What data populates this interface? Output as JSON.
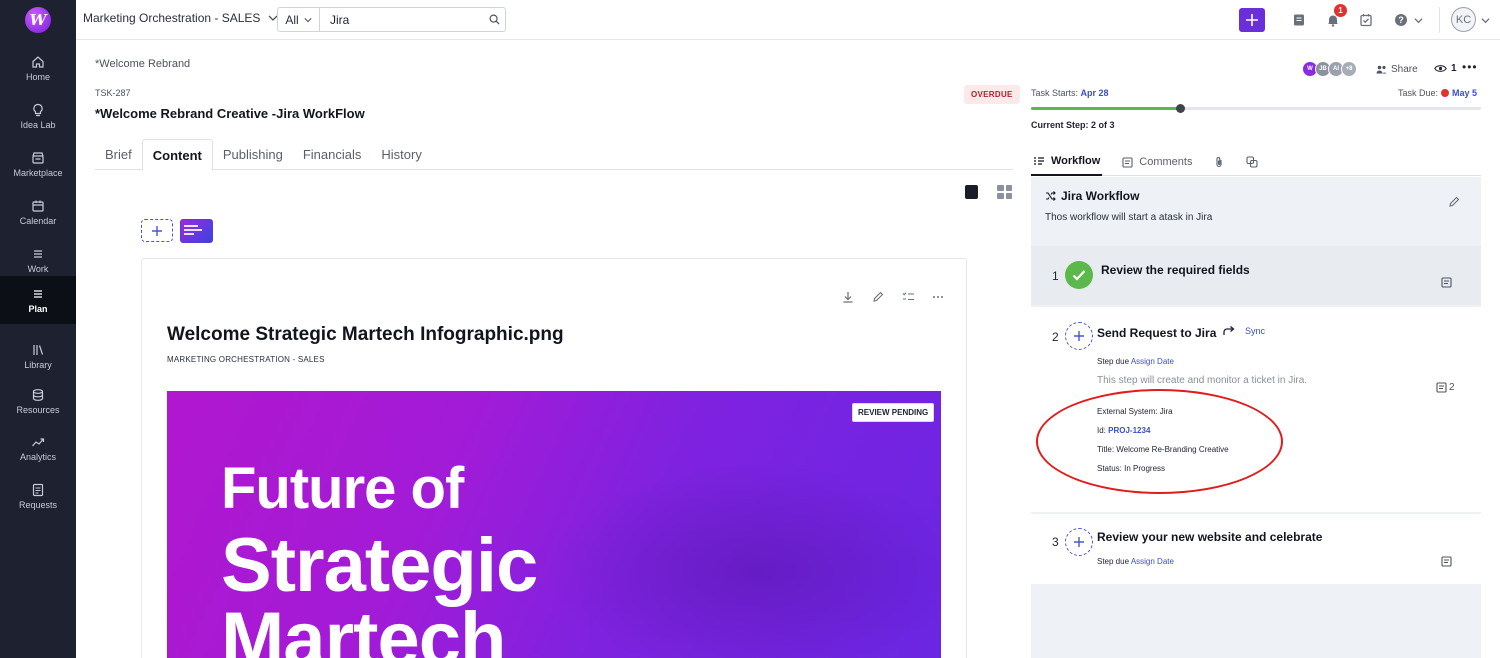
{
  "colors": {
    "accent": "#6a2fd8",
    "link": "#3b4fc8",
    "success": "#5bb84a",
    "danger": "#e03131",
    "sidebar": "#1d2130"
  },
  "app": {
    "logo_letter": "W"
  },
  "topbar": {
    "workspace": "Marketing Orchestration - SALES",
    "search_filter": "All",
    "search_value": "Jira",
    "notifications_count": "1",
    "user_initials": "KC"
  },
  "sidebar": {
    "items": [
      {
        "label": "Home",
        "icon": "home-icon"
      },
      {
        "label": "Idea Lab",
        "icon": "bulb-icon"
      },
      {
        "label": "Marketplace",
        "icon": "store-icon"
      },
      {
        "label": "Calendar",
        "icon": "calendar-icon"
      },
      {
        "label": "Work",
        "icon": "list-icon"
      },
      {
        "label": "Plan",
        "icon": "plan-icon",
        "active": true
      },
      {
        "label": "Library",
        "icon": "library-icon"
      },
      {
        "label": "Resources",
        "icon": "database-icon"
      },
      {
        "label": "Analytics",
        "icon": "chart-icon"
      },
      {
        "label": "Requests",
        "icon": "request-icon"
      }
    ]
  },
  "task": {
    "breadcrumb": "*Welcome Rebrand",
    "id": "TSK-287",
    "title": "*Welcome Rebrand Creative -Jira WorkFlow",
    "status_badge": "OVERDUE",
    "tabs": [
      "Brief",
      "Content",
      "Publishing",
      "Financials",
      "History"
    ],
    "active_tab": "Content"
  },
  "asset": {
    "title": "Welcome Strategic Martech Infographic.png",
    "subtitle": "MARKETING ORCHESTRATION - SALES",
    "badge": "REVIEW PENDING",
    "preview_lines": [
      "Future of",
      "Strategic",
      "Martech"
    ]
  },
  "right": {
    "avatars": [
      "W",
      "JB",
      "AI",
      "+8"
    ],
    "share_label": "Share",
    "watchers": "1",
    "task_starts_label": "Task Starts:",
    "task_starts": "Apr 28",
    "task_due_label": "Task Due:",
    "task_due": "May 5",
    "current_step": "Current Step: 2 of 3",
    "progress_fraction": 0.33,
    "tabs": [
      "Workflow",
      "Comments"
    ]
  },
  "workflow": {
    "title": "Jira Workflow",
    "description": "Thos workflow will start a atask in Jira",
    "steps": [
      {
        "num": "1",
        "title": "Review the required fields"
      },
      {
        "num": "2",
        "title": "Send Request to Jira",
        "action": "Sync",
        "due_label": "Step due",
        "due_link": "Assign Date",
        "info": "This step will create and monitor a ticket in Jira.",
        "comment_count": "2",
        "external_system": "External System: Jira",
        "id_label": "Id:",
        "id_value": "PROJ-1234",
        "ticket_title": "Title: Welcome Re-Branding Creative",
        "ticket_status": "Status: In Progress"
      },
      {
        "num": "3",
        "title": "Review your new website and celebrate",
        "due_label": "Step due",
        "due_link": "Assign Date"
      }
    ]
  }
}
